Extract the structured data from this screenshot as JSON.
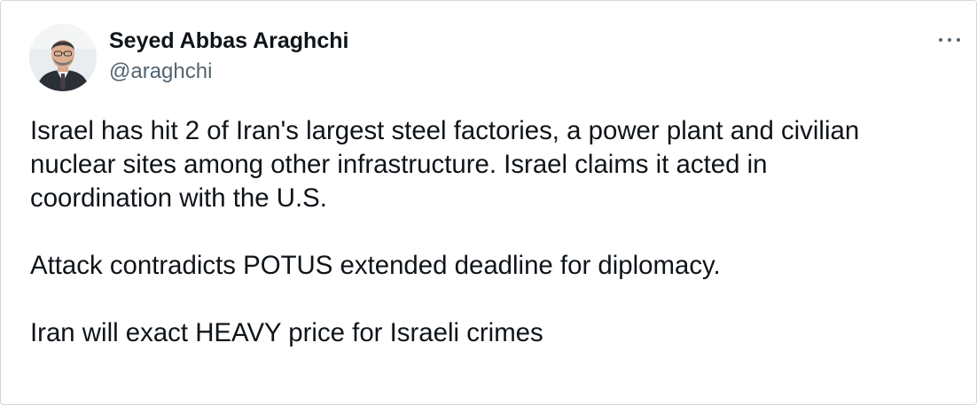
{
  "author": {
    "name": "Seyed Abbas Araghchi",
    "handle": "@araghchi",
    "avatar_icon": "profile-photo"
  },
  "more_icon": "ellipsis-icon",
  "tweet": {
    "lines": [
      "Israel has hit 2 of Iran's largest steel factories, a power plant and civilian",
      "nuclear sites among other infrastructure. Israel claims it acted in",
      "coordination with the U.S.",
      "Attack contradicts POTUS extended deadline for diplomacy.",
      "Iran will exact HEAVY price for Israeli crimes"
    ]
  },
  "colors": {
    "text": "#0f1419",
    "secondary_text": "#536471",
    "border": "#cfd9de"
  }
}
